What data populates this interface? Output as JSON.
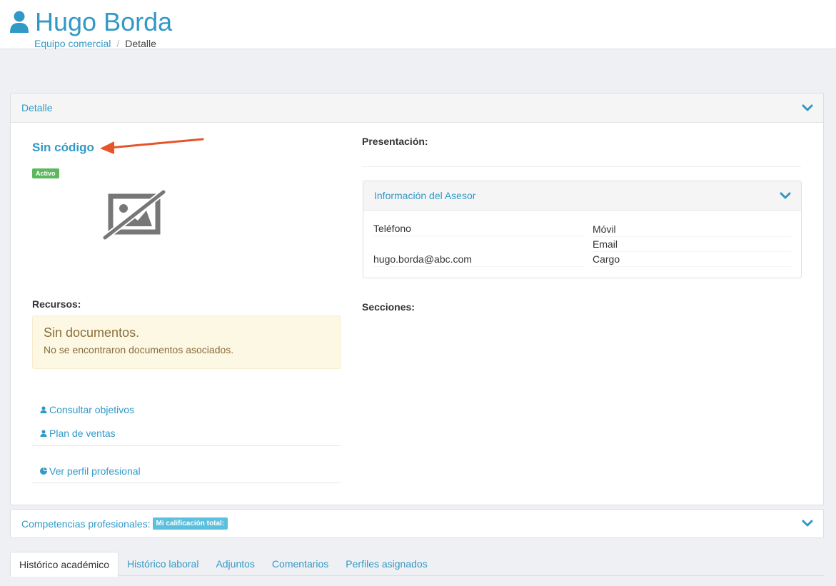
{
  "header": {
    "title": "Hugo Borda",
    "breadcrumb": {
      "parent": "Equipo comercial",
      "separator": "/",
      "current": "Detalle"
    }
  },
  "detail_panel": {
    "heading": "Detalle",
    "code": "Sin código",
    "status": "Activo",
    "image_placeholder_icon": "no-image-icon",
    "resources_label": "Recursos:",
    "alert": {
      "title": "Sin documentos.",
      "text": "No se encontraron documentos asociados."
    },
    "links": [
      {
        "label": "Consultar objetivos",
        "icon": "user-icon"
      },
      {
        "label": "Plan de ventas",
        "icon": "user-icon"
      },
      {
        "label": "Ver perfil profesional",
        "icon": "pie-chart-icon"
      }
    ],
    "presentation_label": "Presentación:",
    "sections_label": "Secciones:",
    "advisor": {
      "heading": "Información del Asesor",
      "phone_label": "Teléfono",
      "mobile_label": "Móvil",
      "email_label": "Email",
      "email_value": "hugo.borda@abc.com",
      "position_label": "Cargo"
    }
  },
  "competencies": {
    "label": "Competencias profesionales:",
    "badge": "Mi calificación total:"
  },
  "tabs": [
    "Histórico académico",
    "Histórico laboral",
    "Adjuntos",
    "Comentarios",
    "Perfiles asignados"
  ],
  "colors": {
    "accent": "#3199c6",
    "success": "#5cb85c",
    "info": "#5bc0de",
    "warning_bg": "#fcf8e3",
    "arrow": "#e8542a"
  }
}
